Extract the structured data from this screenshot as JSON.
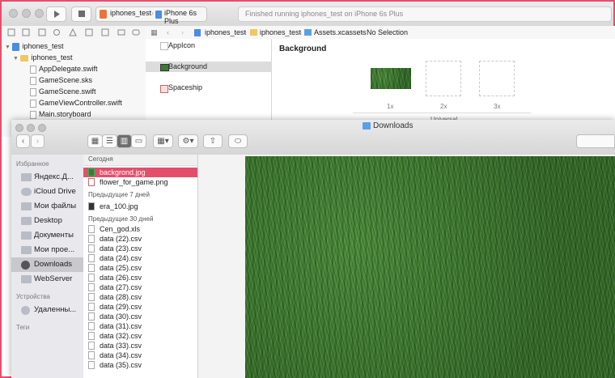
{
  "xcode": {
    "scheme": "iphones_test",
    "device": "iPhone 6s Plus",
    "status": "Finished running iphones_test on iPhone 6s Plus",
    "navigator": [
      {
        "label": "iphones_test",
        "kind": "project",
        "indent": 0
      },
      {
        "label": "iphones_test",
        "kind": "folder",
        "indent": 1
      },
      {
        "label": "AppDelegate.swift",
        "kind": "file",
        "indent": 2
      },
      {
        "label": "GameScene.sks",
        "kind": "file",
        "indent": 2
      },
      {
        "label": "GameScene.swift",
        "kind": "file",
        "indent": 2
      },
      {
        "label": "GameViewController.swift",
        "kind": "file",
        "indent": 2
      },
      {
        "label": "Main.storyboard",
        "kind": "file",
        "indent": 2
      }
    ],
    "jumpbar": [
      "iphones_test",
      "iphones_test",
      "Assets.xcassets",
      "No Selection"
    ],
    "assets": [
      "AppIcon",
      "Background",
      "Spaceship"
    ],
    "selected_asset": "Background",
    "canvas_title": "Background",
    "scales": [
      "1x",
      "2x",
      "3x"
    ],
    "universal_label": "Universal"
  },
  "finder": {
    "title": "Downloads",
    "sidebar": {
      "favorites_header": "Избранное",
      "favorites": [
        "Яндекс.Д...",
        "iCloud Drive",
        "Мои файлы",
        "Desktop",
        "Документы",
        "Мои прое...",
        "Downloads",
        "WebServer"
      ],
      "selected": "Downloads",
      "devices_header": "Устройства",
      "devices": [
        "Удаленны..."
      ],
      "tags_header": "Теги"
    },
    "list": {
      "today_header": "Сегодня",
      "today": [
        "backgrond.jpg",
        "flower_for_game.png"
      ],
      "week_header": "Предыдущие 7 дней",
      "week": [
        "era_100.jpg"
      ],
      "month_header": "Предыдущие 30 дней",
      "month": [
        "Cen_god.xls",
        "data (22).csv",
        "data (23).csv",
        "data (24).csv",
        "data (25).csv",
        "data (26).csv",
        "data (27).csv",
        "data (28).csv",
        "data (29).csv",
        "data (30).csv",
        "data (31).csv",
        "data (32).csv",
        "data (33).csv",
        "data (34).csv",
        "data (35).csv"
      ]
    },
    "selected_file": "backgrond.jpg"
  }
}
